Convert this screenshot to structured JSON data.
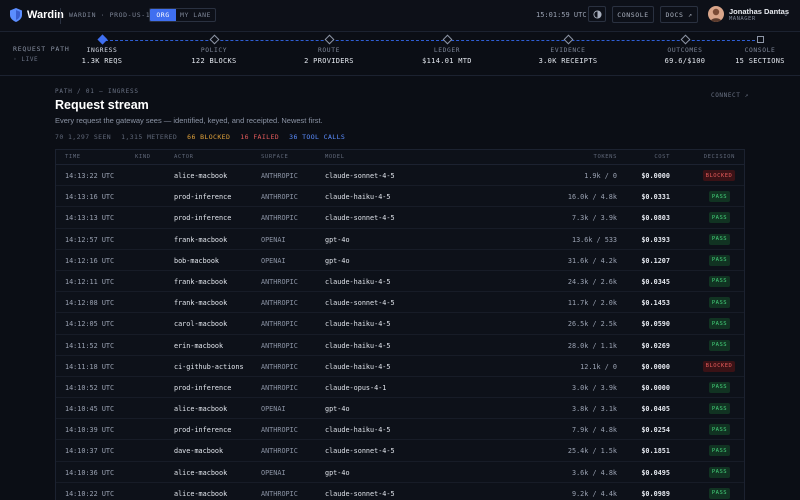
{
  "app": {
    "brand": "Wardin",
    "environment": "WARDIN · PROD-US-1",
    "scope_options": [
      "ORG",
      "MY LANE"
    ],
    "scope_selected": "ORG",
    "clock": "15:01:59 UTC",
    "console_label": "CONSOLE",
    "docs_label": "DOCS ↗",
    "user": {
      "name": "Jonathas Dantas",
      "role": "MANAGER"
    }
  },
  "pipeline": {
    "label": "REQUEST PATH",
    "live": "◦ LIVE",
    "stages": [
      {
        "name": "INGRESS",
        "value": "1.3K REQS",
        "active": true,
        "shape": "diamond"
      },
      {
        "name": "POLICY",
        "value": "122 BLOCKS",
        "active": false,
        "shape": "diamond"
      },
      {
        "name": "ROUTE",
        "value": "2 PROVIDERS",
        "active": false,
        "shape": "diamond"
      },
      {
        "name": "LEDGER",
        "value": "$114.01 MTD",
        "active": false,
        "shape": "diamond"
      },
      {
        "name": "EVIDENCE",
        "value": "3.0K RECEIPTS",
        "active": false,
        "shape": "diamond"
      },
      {
        "name": "OUTCOMES",
        "value": "69.6/$100",
        "active": false,
        "shape": "diamond"
      },
      {
        "name": "CONSOLE",
        "value": "15 SECTIONS",
        "active": false,
        "shape": "square"
      }
    ]
  },
  "page": {
    "breadcrumb": "PATH / 01 — INGRESS",
    "connect": "CONNECT ↗",
    "title": "Request stream",
    "subtitle": "Every request the gateway sees — identified, keyed, and receipted. Newest first.",
    "stats": {
      "seen": "70 1,297 SEEN",
      "metered": "1,315 METERED",
      "blocked": "66 BLOCKED",
      "failed": "16 FAILED",
      "tool_calls": "36 TOOL CALLS"
    }
  },
  "table": {
    "columns": [
      "TIME",
      "KIND",
      "ACTOR",
      "SURFACE",
      "MODEL",
      "TOKENS",
      "COST",
      "DECISION"
    ],
    "rows": [
      {
        "time": "14:13:22 UTC",
        "actor": "alice-macbook",
        "surface": "ANTHROPIC",
        "model": "claude-sonnet-4-5",
        "tokens": "1.9k / 0",
        "cost": "$0.0000",
        "decision": "BLOCKED"
      },
      {
        "time": "14:13:16 UTC",
        "actor": "prod-inference",
        "surface": "ANTHROPIC",
        "model": "claude-haiku-4-5",
        "tokens": "16.0k / 4.8k",
        "cost": "$0.0331",
        "decision": "PASS"
      },
      {
        "time": "14:13:13 UTC",
        "actor": "prod-inference",
        "surface": "ANTHROPIC",
        "model": "claude-sonnet-4-5",
        "tokens": "7.3k / 3.9k",
        "cost": "$0.0803",
        "decision": "PASS"
      },
      {
        "time": "14:12:57 UTC",
        "actor": "frank-macbook",
        "surface": "OPENAI",
        "model": "gpt-4o",
        "tokens": "13.6k / 533",
        "cost": "$0.0393",
        "decision": "PASS"
      },
      {
        "time": "14:12:16 UTC",
        "actor": "bob-macbook",
        "surface": "OPENAI",
        "model": "gpt-4o",
        "tokens": "31.6k / 4.2k",
        "cost": "$0.1207",
        "decision": "PASS"
      },
      {
        "time": "14:12:11 UTC",
        "actor": "frank-macbook",
        "surface": "ANTHROPIC",
        "model": "claude-haiku-4-5",
        "tokens": "24.3k / 2.6k",
        "cost": "$0.0345",
        "decision": "PASS"
      },
      {
        "time": "14:12:08 UTC",
        "actor": "frank-macbook",
        "surface": "ANTHROPIC",
        "model": "claude-sonnet-4-5",
        "tokens": "11.7k / 2.0k",
        "cost": "$0.1453",
        "decision": "PASS"
      },
      {
        "time": "14:12:05 UTC",
        "actor": "carol-macbook",
        "surface": "ANTHROPIC",
        "model": "claude-haiku-4-5",
        "tokens": "26.5k / 2.5k",
        "cost": "$0.0590",
        "decision": "PASS"
      },
      {
        "time": "14:11:52 UTC",
        "actor": "erin-macbook",
        "surface": "ANTHROPIC",
        "model": "claude-haiku-4-5",
        "tokens": "28.0k / 1.1k",
        "cost": "$0.0269",
        "decision": "PASS"
      },
      {
        "time": "14:11:18 UTC",
        "actor": "ci-github-actions",
        "surface": "ANTHROPIC",
        "model": "claude-haiku-4-5",
        "tokens": "12.1k / 0",
        "cost": "$0.0000",
        "decision": "BLOCKED"
      },
      {
        "time": "14:10:52 UTC",
        "actor": "prod-inference",
        "surface": "ANTHROPIC",
        "model": "claude-opus-4-1",
        "tokens": "3.0k / 3.9k",
        "cost": "$0.0000",
        "decision": "PASS"
      },
      {
        "time": "14:10:45 UTC",
        "actor": "alice-macbook",
        "surface": "OPENAI",
        "model": "gpt-4o",
        "tokens": "3.8k / 3.1k",
        "cost": "$0.0405",
        "decision": "PASS"
      },
      {
        "time": "14:10:39 UTC",
        "actor": "prod-inference",
        "surface": "ANTHROPIC",
        "model": "claude-haiku-4-5",
        "tokens": "7.9k / 4.8k",
        "cost": "$0.0254",
        "decision": "PASS"
      },
      {
        "time": "14:10:37 UTC",
        "actor": "dave-macbook",
        "surface": "ANTHROPIC",
        "model": "claude-sonnet-4-5",
        "tokens": "25.4k / 1.5k",
        "cost": "$0.1851",
        "decision": "PASS"
      },
      {
        "time": "14:10:36 UTC",
        "actor": "alice-macbook",
        "surface": "OPENAI",
        "model": "gpt-4o",
        "tokens": "3.6k / 4.8k",
        "cost": "$0.0495",
        "decision": "PASS"
      },
      {
        "time": "14:10:22 UTC",
        "actor": "alice-macbook",
        "surface": "ANTHROPIC",
        "model": "claude-sonnet-4-5",
        "tokens": "9.2k / 4.4k",
        "cost": "$0.0989",
        "decision": "PASS"
      }
    ]
  },
  "colors": {
    "background": "#0b0e15",
    "accent": "#3f6ff0",
    "pass_text": "#44d17a",
    "pass_bg": "#113322",
    "blocked_text": "#e35a5a",
    "blocked_bg": "#3a1216",
    "stat_blocked": "#e0a13a",
    "stat_failed": "#e35a5a",
    "stat_tools": "#5b8dff"
  },
  "icons": {
    "logo": "shield-icon",
    "theme": "half-moon-icon",
    "user_menu": "chevron-down-icon"
  }
}
